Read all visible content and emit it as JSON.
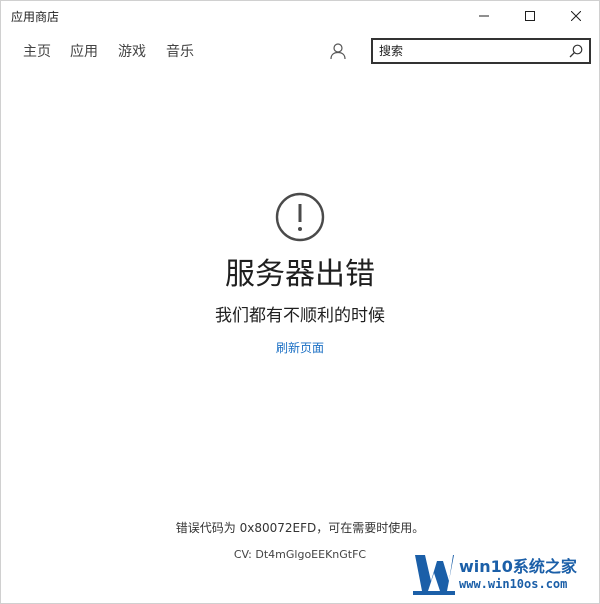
{
  "window": {
    "title": "应用商店"
  },
  "nav": {
    "tabs": [
      {
        "label": "主页"
      },
      {
        "label": "应用"
      },
      {
        "label": "游戏"
      },
      {
        "label": "音乐"
      }
    ]
  },
  "search": {
    "placeholder": "搜索",
    "value": ""
  },
  "error": {
    "icon": "exclamation-circle-icon",
    "title": "服务器出错",
    "subtitle": "我们都有不顺利的时候",
    "refresh_label": "刷新页面",
    "code_text": "错误代码为 0x80072EFD，可在需要时使用。",
    "cv_text": "CV: Dt4mGlgoEEKnGtFC"
  },
  "watermark": {
    "title": "win10系统之家",
    "url": "www.win10os.com"
  },
  "colors": {
    "link": "#1a6fc4",
    "watermark": "#1b5fa8",
    "text": "#1f1f1f"
  }
}
